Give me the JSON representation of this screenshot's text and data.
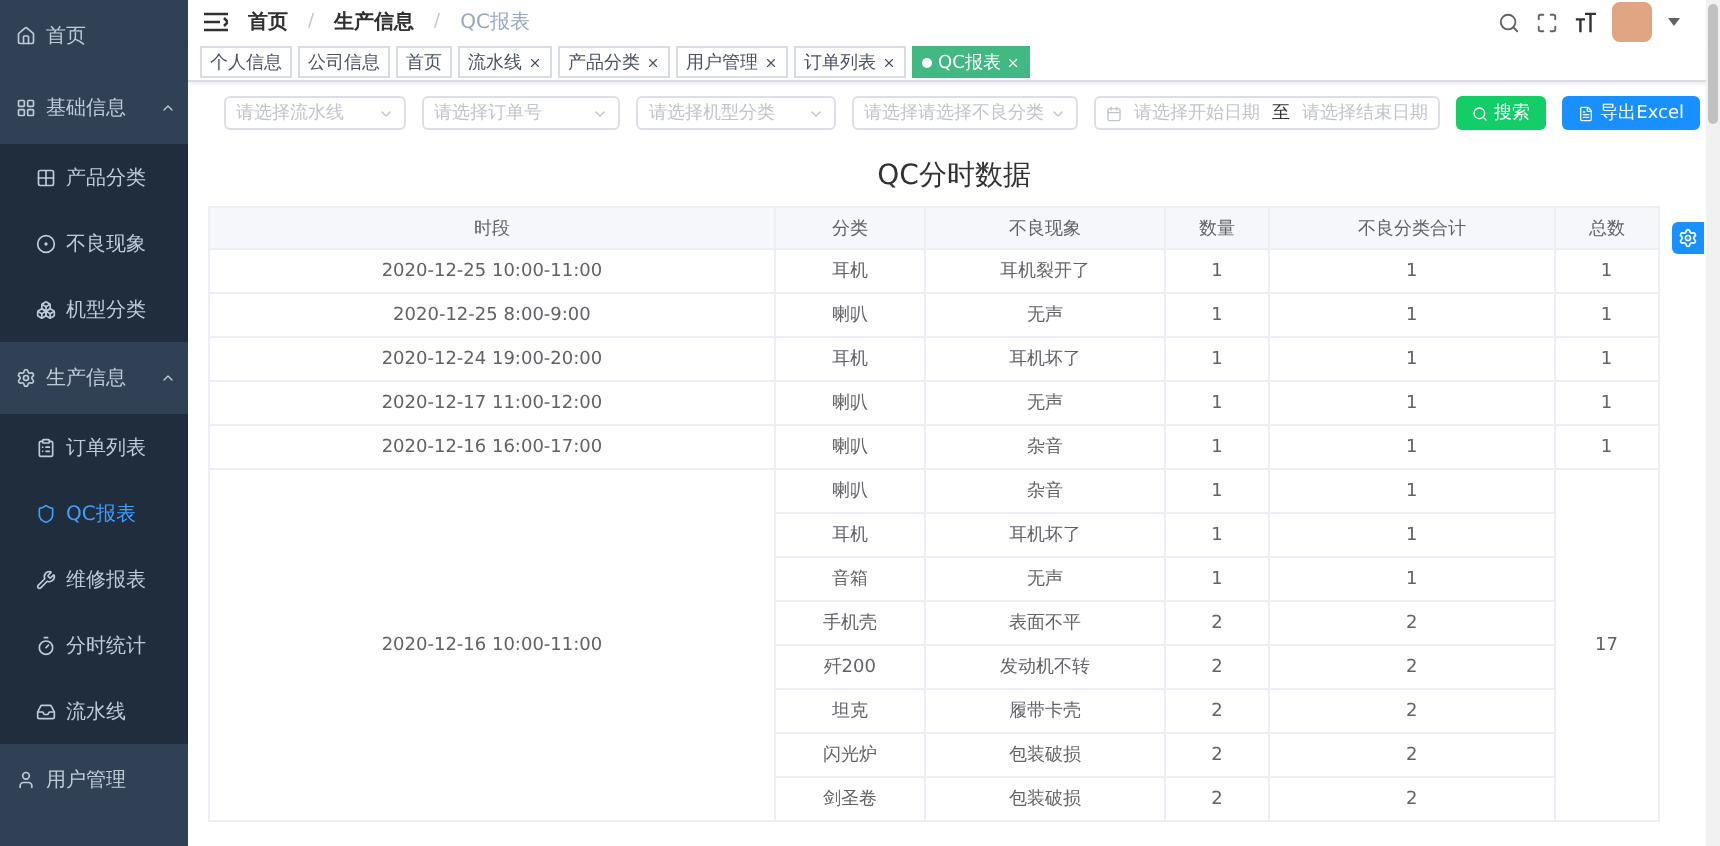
{
  "sidebar": {
    "items": [
      {
        "label": "首页",
        "selected": false
      },
      {
        "label": "基础信息",
        "expanded": true,
        "selected": false,
        "children": [
          {
            "label": "产品分类",
            "selected": false
          },
          {
            "label": "不良现象",
            "selected": false
          },
          {
            "label": "机型分类",
            "selected": false
          }
        ]
      },
      {
        "label": "生产信息",
        "expanded": true,
        "selected": false,
        "children": [
          {
            "label": "订单列表",
            "selected": false
          },
          {
            "label": "QC报表",
            "selected": true
          },
          {
            "label": "维修报表",
            "selected": false
          },
          {
            "label": "分时统计",
            "selected": false
          },
          {
            "label": "流水线",
            "selected": false
          }
        ]
      },
      {
        "label": "用户管理",
        "selected": false
      }
    ]
  },
  "breadcrumb": {
    "separator": "/",
    "items": [
      "首页",
      "生产信息",
      "QC报表"
    ]
  },
  "tags": [
    {
      "label": "个人信息",
      "closable": false,
      "selected": false
    },
    {
      "label": "公司信息",
      "closable": false,
      "selected": false
    },
    {
      "label": "首页",
      "closable": false,
      "selected": false
    },
    {
      "label": "流水线",
      "closable": true,
      "selected": false
    },
    {
      "label": "产品分类",
      "closable": true,
      "selected": false
    },
    {
      "label": "用户管理",
      "closable": true,
      "selected": false
    },
    {
      "label": "订单列表",
      "closable": true,
      "selected": false
    },
    {
      "label": "QC报表",
      "closable": true,
      "selected": true
    }
  ],
  "filters": {
    "selects": [
      {
        "placeholder": "请选择流水线"
      },
      {
        "placeholder": "请选择订单号"
      },
      {
        "placeholder": "请选择机型分类"
      },
      {
        "placeholder": "请选择请选择不良分类"
      }
    ],
    "date_range": {
      "start_placeholder": "请选择开始日期",
      "separator": "至",
      "end_placeholder": "请选择结束日期"
    },
    "buttons": [
      {
        "label": "搜索",
        "kind": "search"
      },
      {
        "label": "导出Excel",
        "kind": "export"
      }
    ]
  },
  "title": "QC分时数据",
  "table": {
    "columns": [
      "时段",
      "分类",
      "不良现象",
      "数量",
      "不良分类合计",
      "总数"
    ],
    "groups": [
      {
        "time": "2020-12-25 10:00-11:00",
        "total": "1",
        "rows": [
          {
            "category": "耳机",
            "defect": "耳机裂开了",
            "qty": "1",
            "subtotal": "1"
          }
        ]
      },
      {
        "time": "2020-12-25 8:00-9:00",
        "total": "1",
        "rows": [
          {
            "category": "喇叭",
            "defect": "无声",
            "qty": "1",
            "subtotal": "1"
          }
        ]
      },
      {
        "time": "2020-12-24 19:00-20:00",
        "total": "1",
        "rows": [
          {
            "category": "耳机",
            "defect": "耳机坏了",
            "qty": "1",
            "subtotal": "1"
          }
        ]
      },
      {
        "time": "2020-12-17 11:00-12:00",
        "total": "1",
        "rows": [
          {
            "category": "喇叭",
            "defect": "无声",
            "qty": "1",
            "subtotal": "1"
          }
        ]
      },
      {
        "time": "2020-12-16 16:00-17:00",
        "total": "1",
        "rows": [
          {
            "category": "喇叭",
            "defect": "杂音",
            "qty": "1",
            "subtotal": "1"
          }
        ]
      },
      {
        "time": "2020-12-16 10:00-11:00",
        "total": "17",
        "rows": [
          {
            "category": "喇叭",
            "defect": "杂音",
            "qty": "1",
            "subtotal": "1"
          },
          {
            "category": "耳机",
            "defect": "耳机坏了",
            "qty": "1",
            "subtotal": "1"
          },
          {
            "category": "音箱",
            "defect": "无声",
            "qty": "1",
            "subtotal": "1"
          },
          {
            "category": "手机壳",
            "defect": "表面不平",
            "qty": "2",
            "subtotal": "2"
          },
          {
            "category": "歼200",
            "defect": "发动机不转",
            "qty": "2",
            "subtotal": "2"
          },
          {
            "category": "坦克",
            "defect": "履带卡壳",
            "qty": "2",
            "subtotal": "2"
          },
          {
            "category": "闪光炉",
            "defect": "包装破损",
            "qty": "2",
            "subtotal": "2"
          },
          {
            "category": "剑圣卷",
            "defect": "包装破损",
            "qty": "2",
            "subtotal": "2"
          }
        ]
      }
    ]
  }
}
